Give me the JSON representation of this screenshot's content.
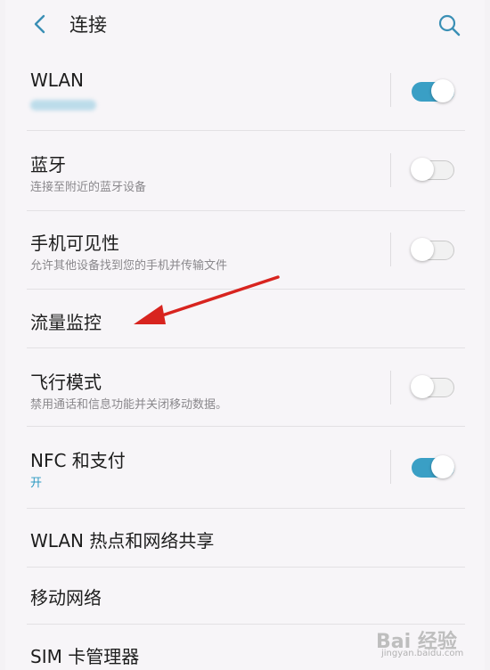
{
  "header": {
    "title": "连接",
    "back_icon": "chevron-left-icon",
    "search_icon": "search-icon"
  },
  "rows": [
    {
      "label": "WLAN",
      "toggle": "on"
    },
    {
      "label": "蓝牙",
      "subtitle": "连接至附近的蓝牙设备",
      "toggle": "off"
    },
    {
      "label": "手机可见性",
      "subtitle": "允许其他设备找到您的手机并传输文件",
      "toggle": "off"
    },
    {
      "label": "流量监控"
    },
    {
      "label": "飞行模式",
      "subtitle": "禁用通话和信息功能并关闭移动数据。",
      "toggle": "off"
    },
    {
      "label": "NFC 和支付",
      "subtitle": "开",
      "toggle": "on"
    },
    {
      "label": "WLAN 热点和网络共享"
    },
    {
      "label": "移动网络"
    },
    {
      "label": "SIM 卡管理器"
    }
  ],
  "watermark": {
    "text": "Bai 经验",
    "sub": "jingyan.baidu.com"
  },
  "colors": {
    "accent": "#3a9fc5",
    "annotation_arrow": "#d8241f"
  }
}
